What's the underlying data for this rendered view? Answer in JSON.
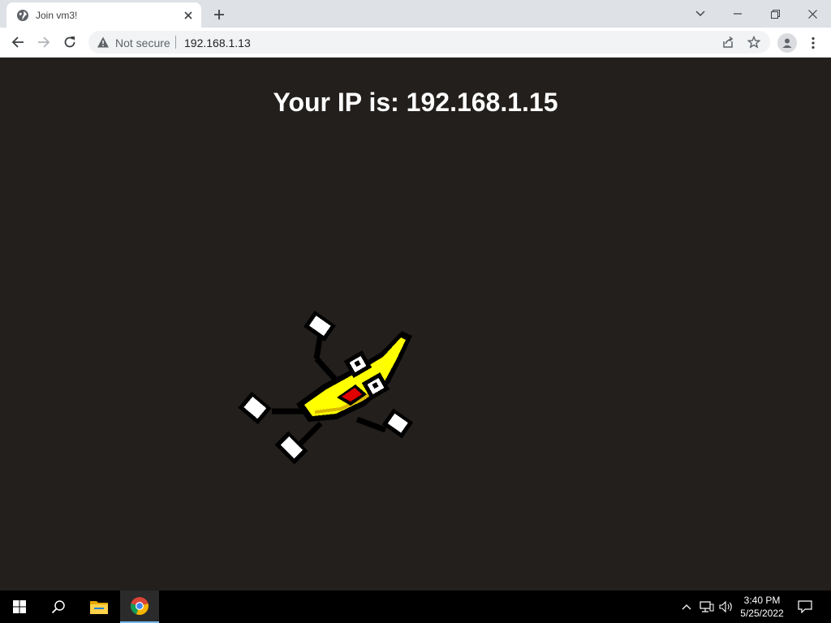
{
  "browser": {
    "tab_title": "Join vm3!",
    "security_label": "Not secure",
    "url": "192.168.1.13"
  },
  "page": {
    "heading": "Your IP is: 192.168.1.15"
  },
  "taskbar": {
    "time": "3:40 PM",
    "date": "5/25/2022"
  },
  "colors": {
    "page_background": "#221f1c",
    "heading_text": "#ffffff",
    "banana_yellow": "#ffff00",
    "mouth_red": "#e00000"
  }
}
